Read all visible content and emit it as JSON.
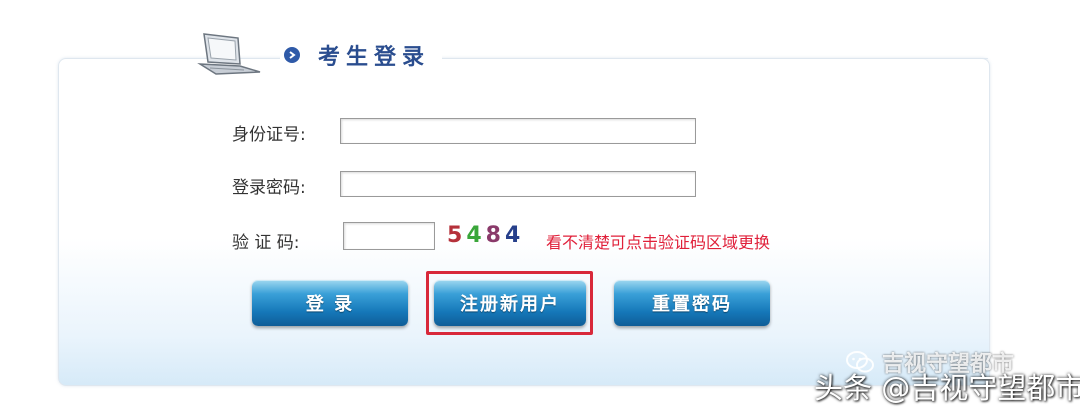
{
  "header": {
    "title": "考生登录"
  },
  "form": {
    "id_label": "身份证号:",
    "id_value": "",
    "password_label": "登录密码:",
    "password_value": "",
    "captcha_label": "验 证 码:",
    "captcha_value": "",
    "captcha_digits": [
      {
        "char": "5",
        "color": "#b5313a"
      },
      {
        "char": "4",
        "color": "#3aa63a"
      },
      {
        "char": "8",
        "color": "#8a3a6a"
      },
      {
        "char": "4",
        "color": "#27408b"
      }
    ],
    "captcha_hint": "看不清楚可点击验证码区域更换"
  },
  "buttons": {
    "login": "登 录",
    "register": "注册新用户",
    "reset": "重置密码"
  },
  "watermark": {
    "small": "吉视守望都市",
    "big": "头条 @吉视守望都市"
  },
  "colors": {
    "accent": "#1577b8",
    "highlight": "#d8283a",
    "title": "#2a4d8f",
    "hint": "#e0203a"
  }
}
